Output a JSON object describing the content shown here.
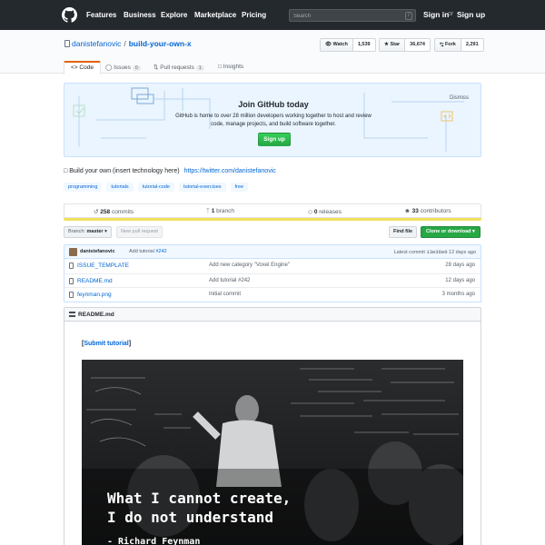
{
  "header": {
    "nav": [
      "Features",
      "Business",
      "Explore",
      "Marketplace",
      "Pricing"
    ],
    "search_placeholder": "Search",
    "search_key": "/",
    "sign_in": "Sign in",
    "or": "or",
    "sign_up": "Sign up"
  },
  "repo": {
    "owner": "danistefanovic",
    "separator": "/",
    "name": "build-your-own-x",
    "watch_label": "Watch",
    "watch_count": "1,539",
    "star_label": "Star",
    "star_count": "36,674",
    "fork_label": "Fork",
    "fork_count": "2,291"
  },
  "tabs": [
    {
      "label": "Code"
    },
    {
      "label": "Issues",
      "count": "0"
    },
    {
      "label": "Pull requests",
      "count": "1"
    },
    {
      "label": "Insights"
    }
  ],
  "signup_banner": {
    "title": "Join GitHub today",
    "text": "GitHub is home to over 28 million developers working together to host and review code, manage projects, and build software together.",
    "button": "Sign up",
    "dismiss": "Dismiss"
  },
  "description": {
    "text": "Build your own (insert technology here)",
    "url": "https://twitter.com/danistefanovic"
  },
  "topics": [
    "programming",
    "tutorials",
    "tutorial-code",
    "tutorial-exercises",
    "free"
  ],
  "summary": {
    "commits_count": "258",
    "commits_label": "commits",
    "branches_count": "1",
    "branches_label": "branch",
    "releases_count": "0",
    "releases_label": "releases",
    "contributors_count": "33",
    "contributors_label": "contributors",
    "language_color": "#f1e05a"
  },
  "file_nav": {
    "branch_prefix": "Branch:",
    "branch": "master",
    "branch_caret": "▾",
    "new_pr": "New pull request",
    "find_file": "Find file",
    "clone": "Clone or download",
    "clone_caret": "▾"
  },
  "commit_tease": {
    "author": "danistefanovic",
    "message": "Add tutorial",
    "pr": "#242",
    "latest_label": "Latest commit",
    "sha": "13e36e0",
    "age": "12 days ago"
  },
  "files": [
    {
      "name": "ISSUE_TEMPLATE",
      "message": "Add new category \"Voxel Engine\"",
      "age": "28 days ago"
    },
    {
      "name": "README.md",
      "message": "Add tutorial #242",
      "age": "12 days ago"
    },
    {
      "name": "feynman.png",
      "message": "Initial commit",
      "age": "3 months ago"
    }
  ],
  "readme": {
    "title": "README.md",
    "submit_open": "[",
    "submit_link": "Submit tutorial",
    "submit_close": "]",
    "quote_line1": "What I cannot create,",
    "quote_line2": "I do not understand",
    "quote_author": "- Richard Feynman"
  },
  "colors": {
    "header_bg": "#24292e",
    "link": "#0366d6",
    "success": "#28a745",
    "tab_accent": "#e36209"
  }
}
